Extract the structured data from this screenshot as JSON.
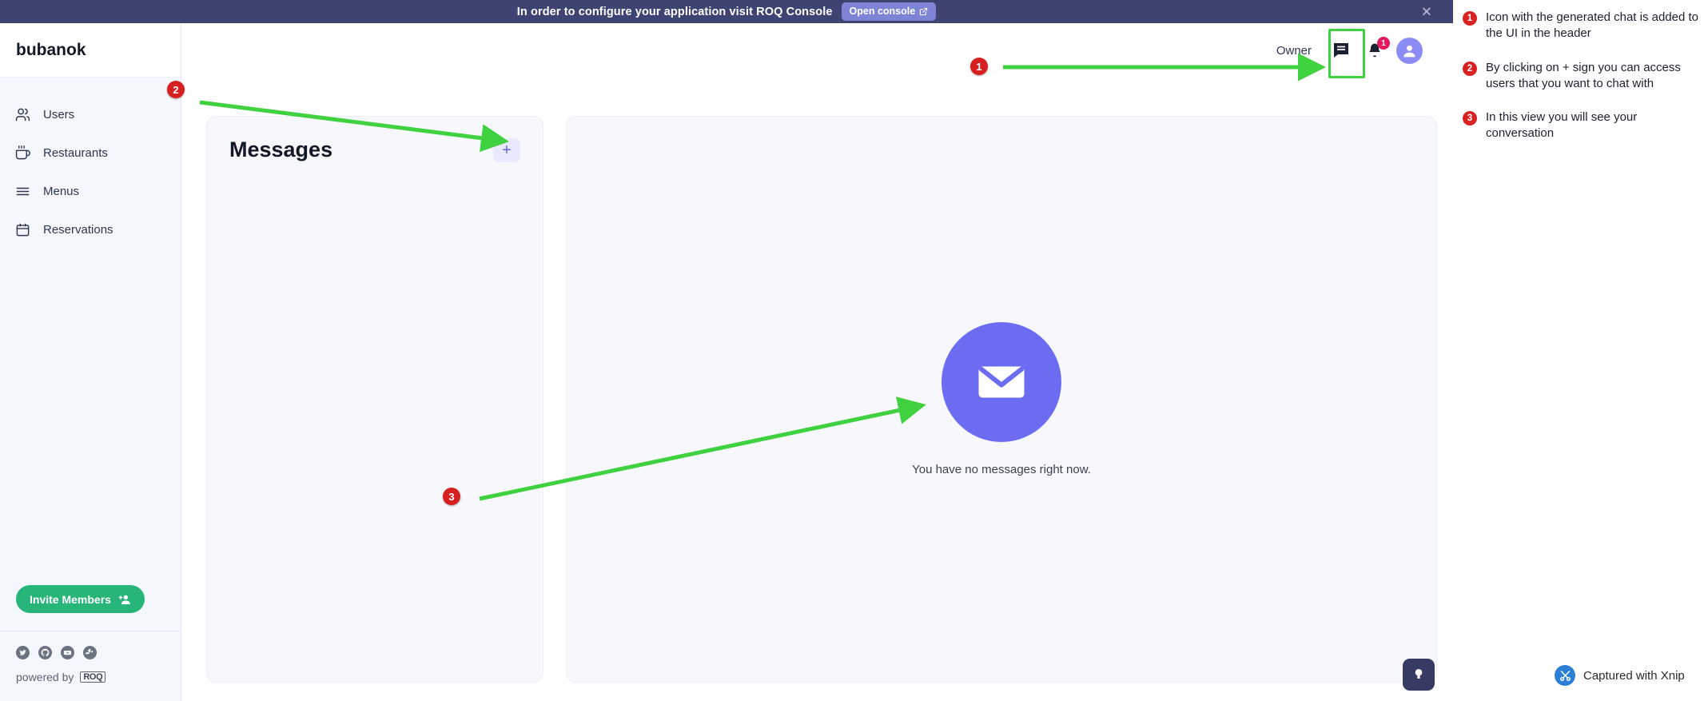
{
  "banner": {
    "text": "In order to configure your application visit ROQ Console",
    "button_label": "Open console",
    "button_icon": "external-link-icon",
    "close_icon": "close-icon",
    "bg_color": "#3f4372",
    "button_color": "#7e83d6"
  },
  "sidebar": {
    "brand": "bubanok",
    "items": [
      {
        "label": "Users",
        "icon": "users-icon"
      },
      {
        "label": "Restaurants",
        "icon": "coffee-cup-icon"
      },
      {
        "label": "Menus",
        "icon": "hamburger-menu-icon"
      },
      {
        "label": "Reservations",
        "icon": "calendar-icon"
      }
    ],
    "invite_label": "Invite Members",
    "invite_icon": "add-person-icon",
    "invite_color": "#27b579",
    "socials": [
      {
        "name": "twitter-icon"
      },
      {
        "name": "github-icon"
      },
      {
        "name": "youtube-icon"
      },
      {
        "name": "slack-icon"
      }
    ],
    "powered_by_text": "powered by",
    "powered_by_brand": "ROQ"
  },
  "header": {
    "owner_label": "Owner",
    "chat_icon": "chat-bubble-icon",
    "bell_icon": "bell-icon",
    "bell_badge": "1",
    "badge_color": "#e5175e",
    "avatar_icon": "user-avatar-icon",
    "avatar_color": "#8b8cf5"
  },
  "messages_panel": {
    "title": "Messages",
    "add_label": "+",
    "add_icon": "plus-icon"
  },
  "conversation_panel": {
    "empty_icon": "envelope-icon",
    "empty_icon_color": "#6c6cf2",
    "empty_text": "You have no messages right now."
  },
  "annotations": {
    "accent_color": "#d82121",
    "arrow_color": "#3fd13f",
    "items": [
      {
        "num": "1",
        "text": "Icon with the generated chat is added to the UI in the header"
      },
      {
        "num": "2",
        "text": "By clicking on + sign you can access users that you want to chat with"
      },
      {
        "num": "3",
        "text": "In this view you will see your conversation"
      }
    ],
    "markers": [
      "1",
      "2",
      "3"
    ]
  },
  "footer": {
    "help_icon": "lightbulb-icon",
    "watermark_text": "Captured with Xnip",
    "watermark_icon": "scissors-icon"
  }
}
